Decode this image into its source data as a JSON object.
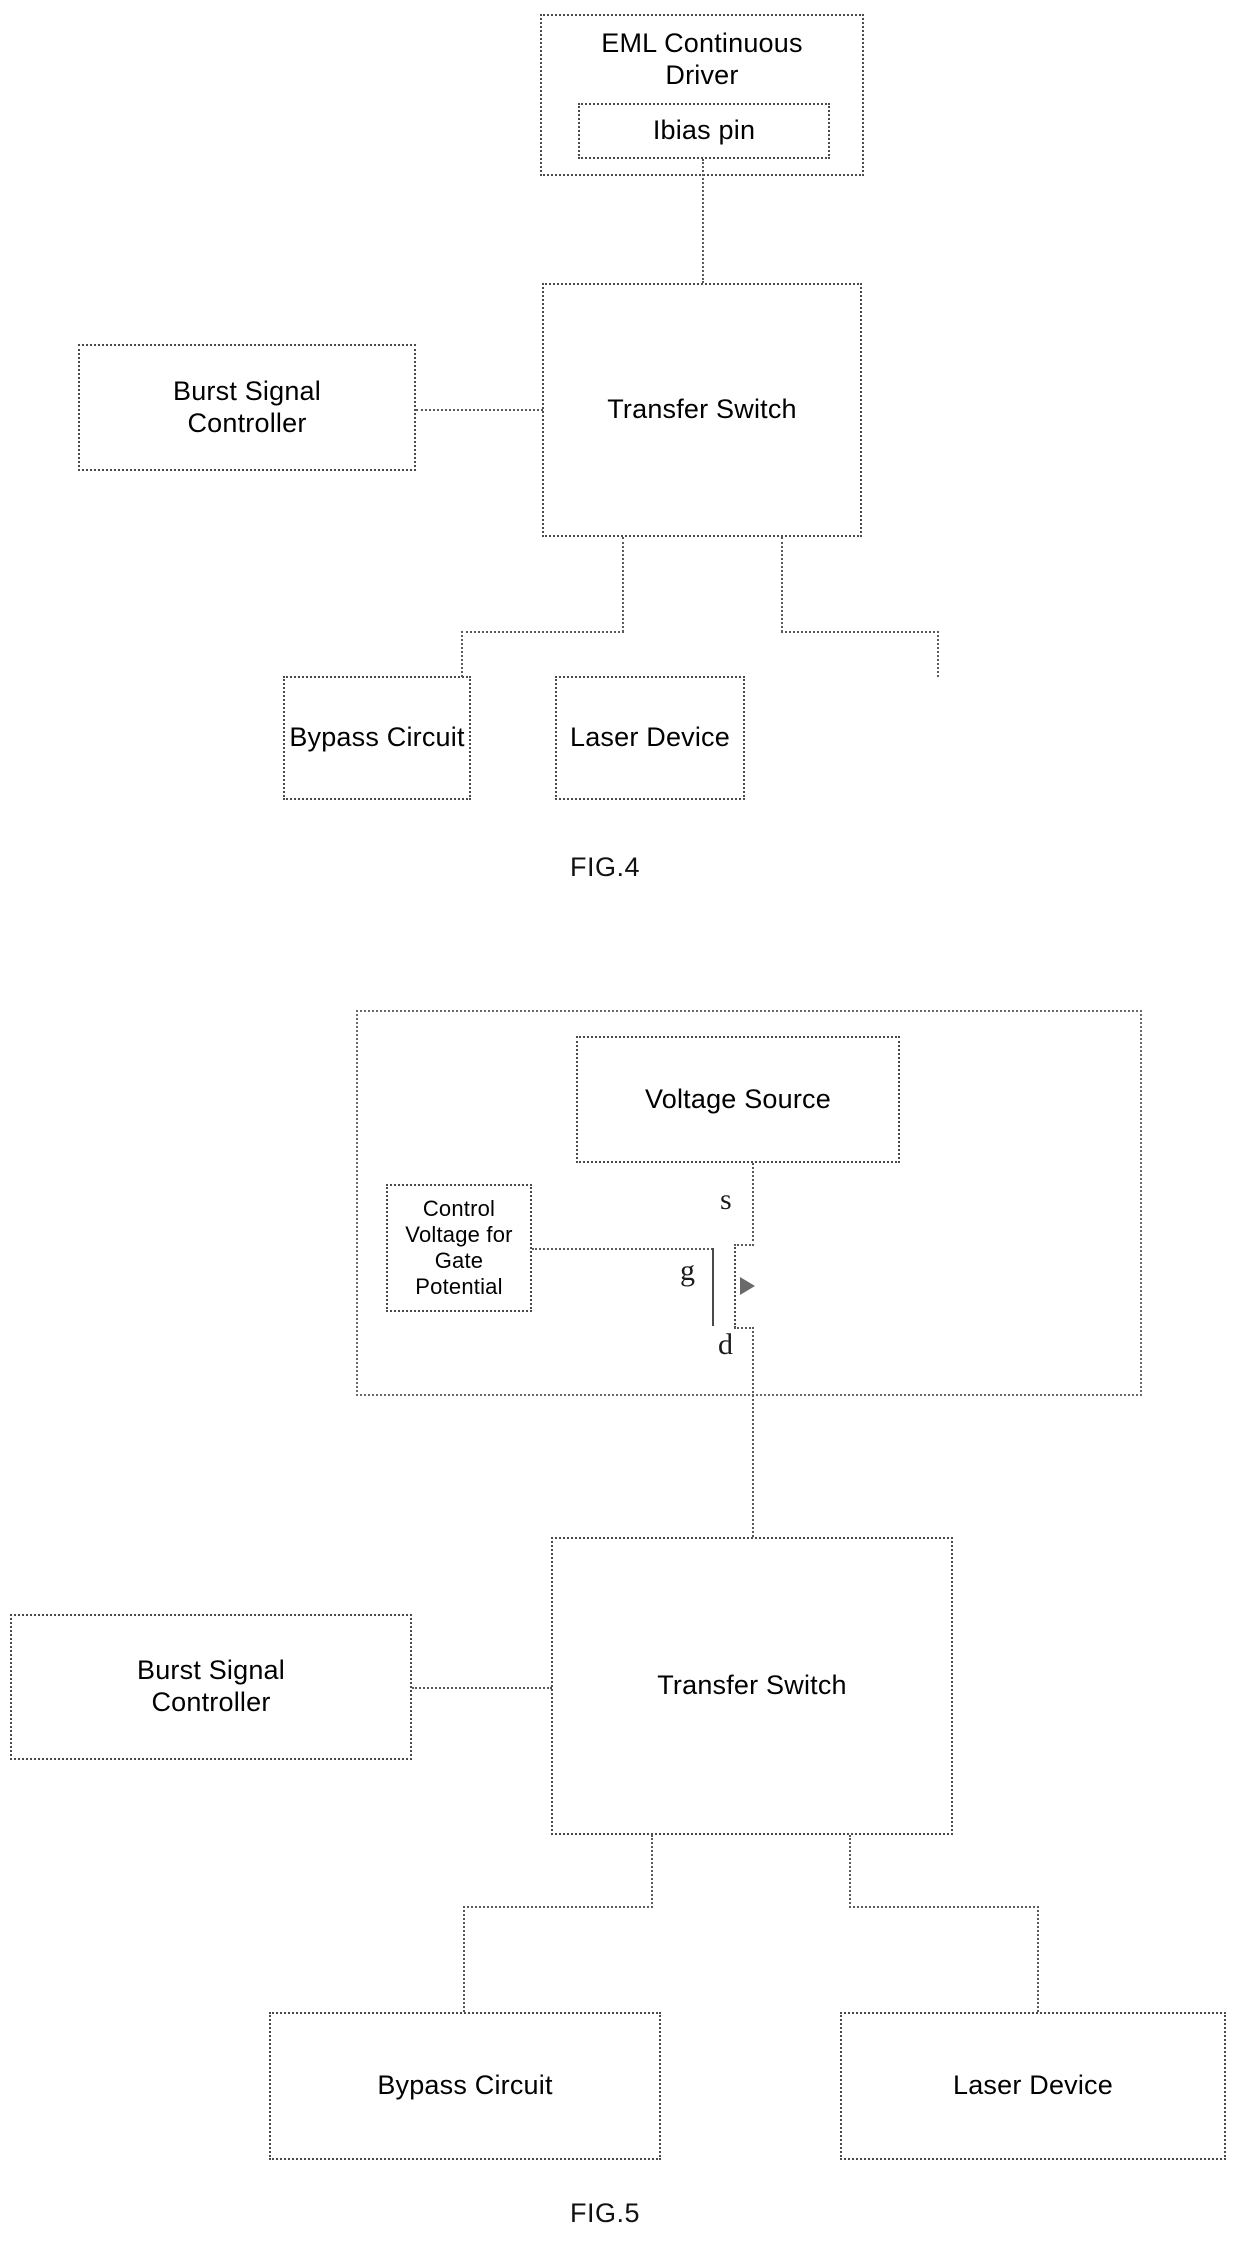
{
  "figures": [
    {
      "caption": "FIG.4",
      "blocks": {
        "driver": "EML Continuous Driver",
        "ibias_pin": "Ibias pin",
        "burst_controller": "Burst Signal Controller",
        "transfer_switch": "Transfer Switch",
        "bypass_circuit": "Bypass Circuit",
        "laser_device": "Laser Device"
      }
    },
    {
      "caption": "FIG.5",
      "blocks": {
        "voltage_source": "Voltage Source",
        "control_voltage": "Control Voltage for Gate Potential",
        "burst_controller": "Burst Signal Controller",
        "transfer_switch": "Transfer Switch",
        "bypass_circuit": "Bypass Circuit",
        "laser_device": "Laser Device"
      },
      "transistor": {
        "source_terminal": "s",
        "gate_terminal": "g",
        "drain_terminal": "d"
      }
    }
  ],
  "fig4": {
    "caption": "FIG.4",
    "driver_line1": "EML Continuous",
    "driver_line2": "Driver",
    "driver_full": "EML Continuous Driver",
    "ibias_pin": "Ibias pin",
    "burst_line1": "Burst Signal",
    "burst_line2": "Controller",
    "transfer_switch": "Transfer Switch",
    "bypass_circuit": "Bypass Circuit",
    "laser_device": "Laser Device"
  },
  "fig5": {
    "caption": "FIG.5",
    "voltage_source": "Voltage Source",
    "control_line1": "Control",
    "control_line2": "Voltage for",
    "control_line3": "Gate Potential",
    "control_full": "Control Voltage for Gate Potential",
    "burst_line1": "Burst Signal",
    "burst_line2": "Controller",
    "transfer_switch": "Transfer Switch",
    "bypass_circuit": "Bypass Circuit",
    "laser_device": "Laser Device",
    "mosfet": {
      "s": "s",
      "g": "g",
      "d": "d"
    }
  },
  "colors": {
    "ink": "#000000",
    "line": "#5a5a5a",
    "background": "#ffffff"
  }
}
